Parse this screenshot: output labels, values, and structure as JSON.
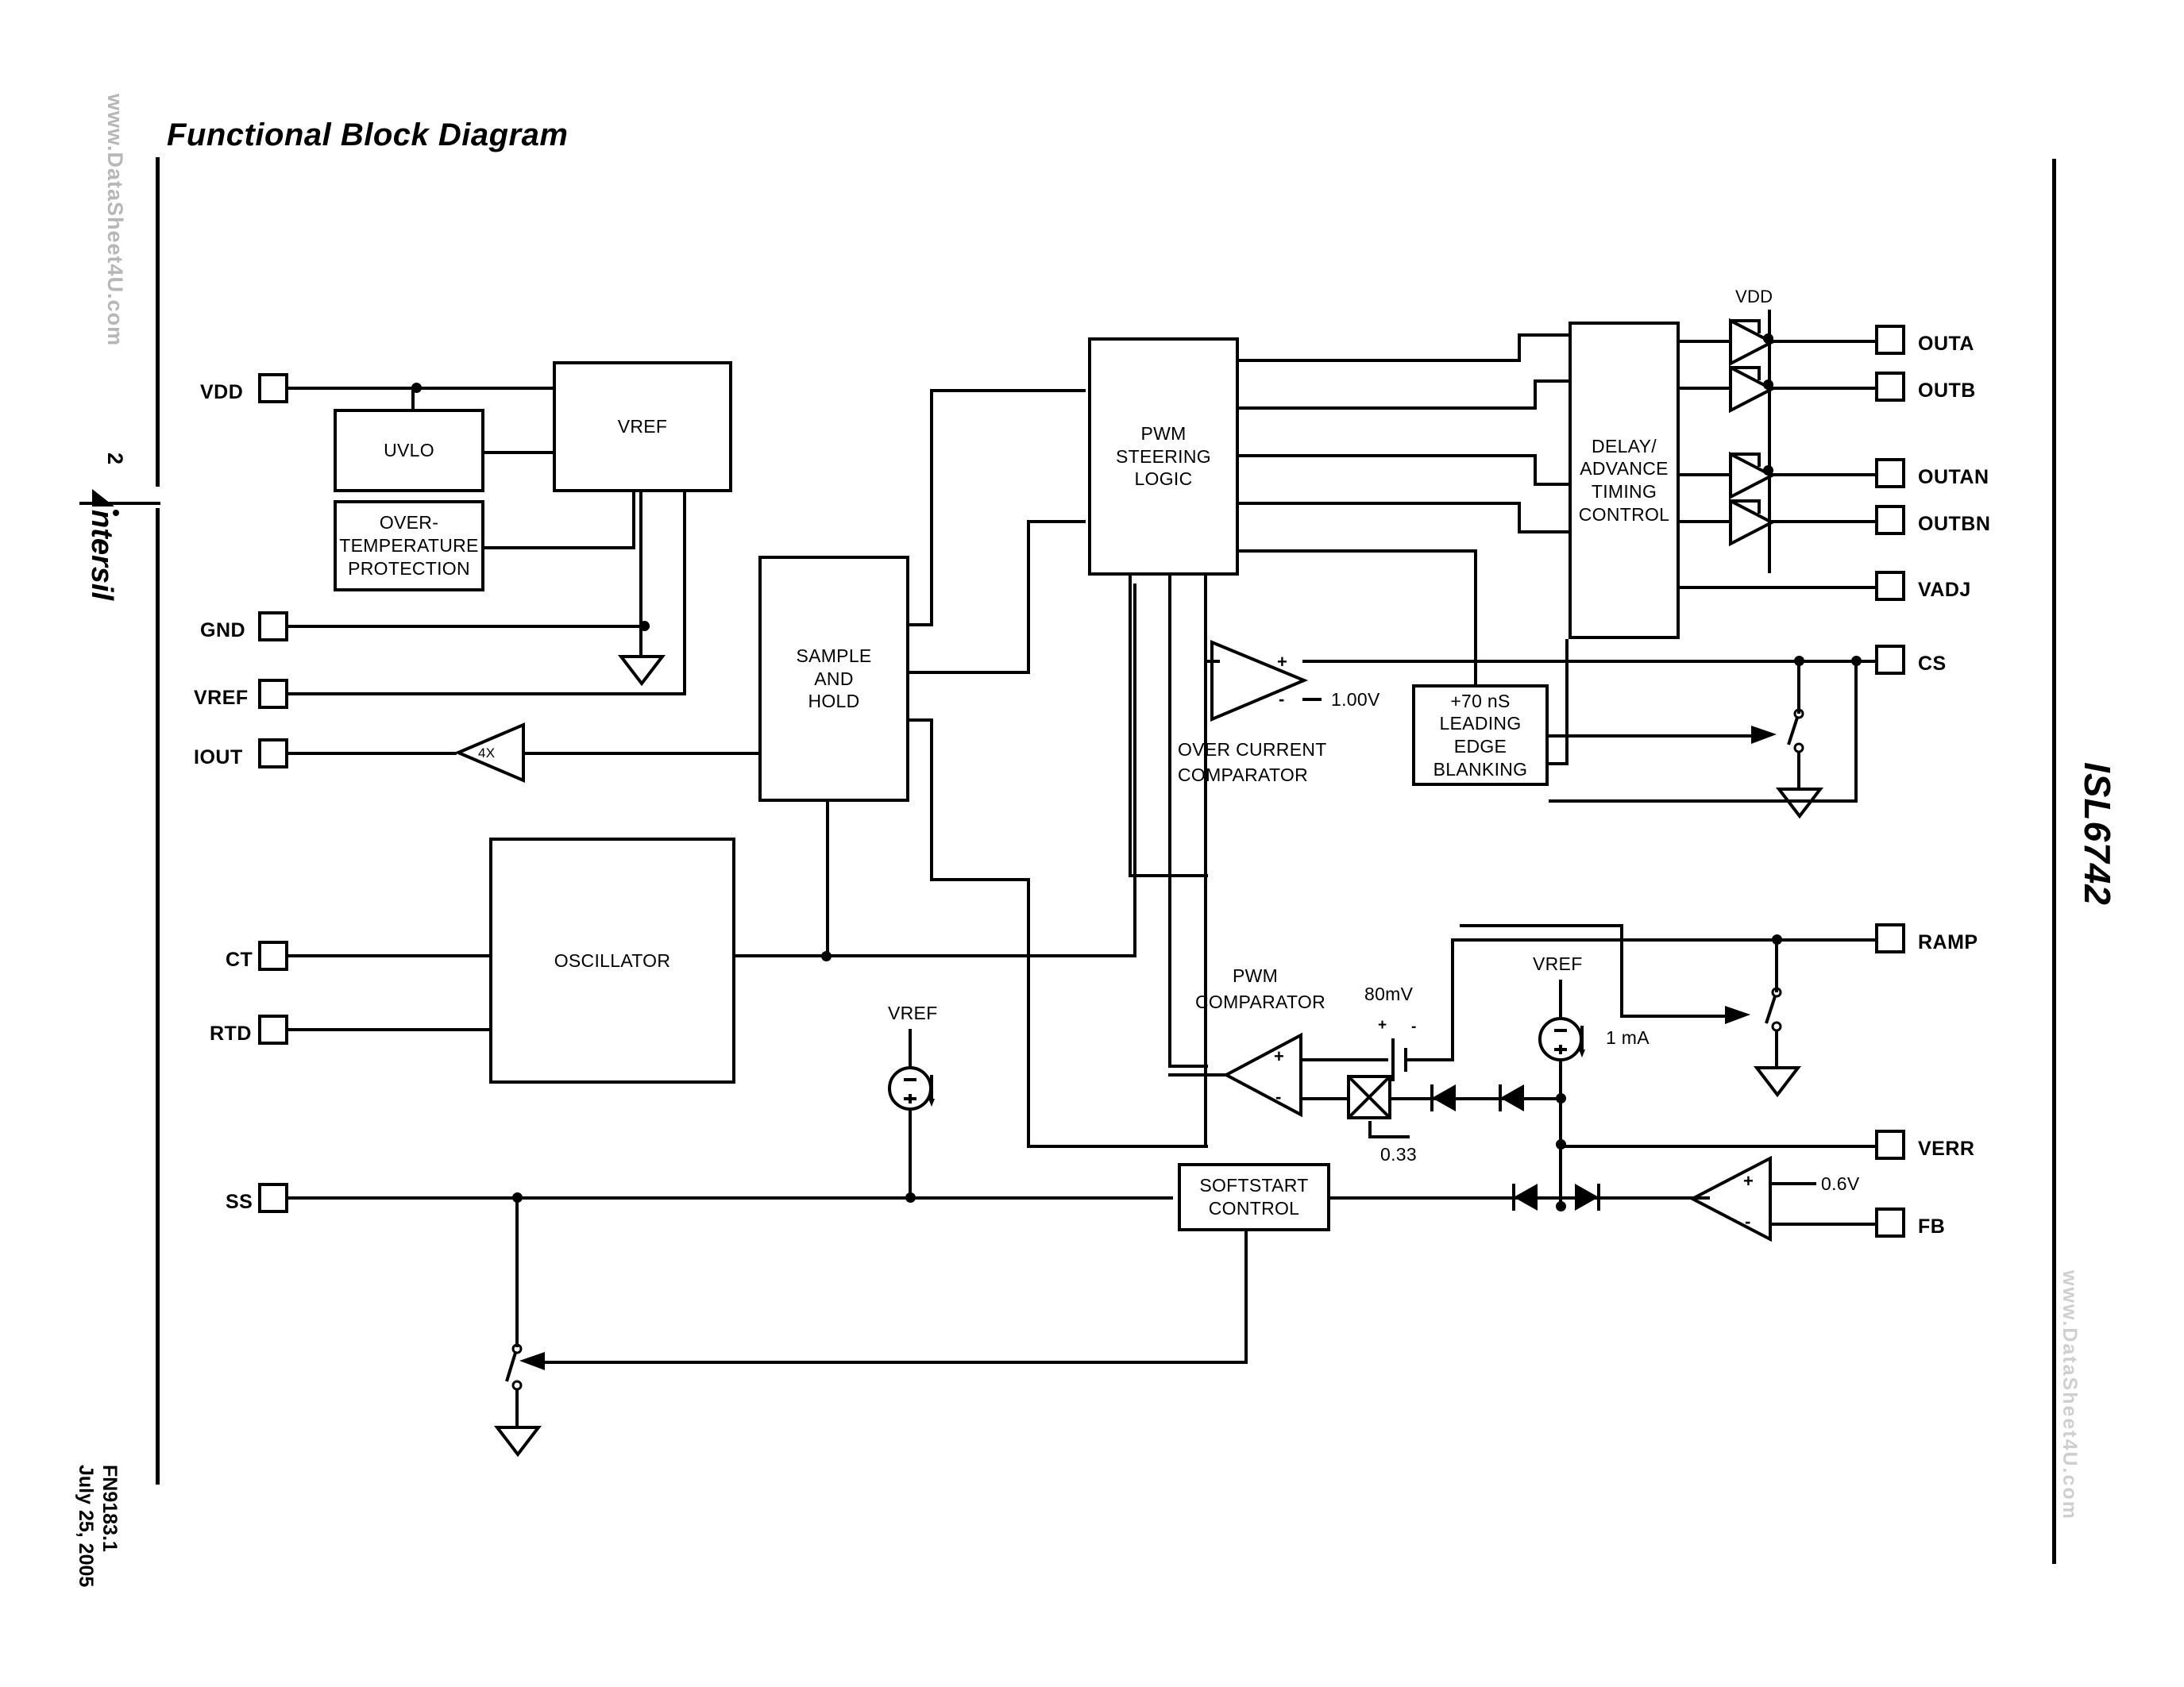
{
  "page": {
    "title": "Functional Block Diagram",
    "page_number": "2",
    "part_number": "ISL6742",
    "doc_number": "FN9183.1",
    "doc_date": "July 25, 2005",
    "company_logo": "intersil",
    "watermark_left": "www.DataSheet4U.com",
    "watermark_right": "www.DataSheet4U.com"
  },
  "pins": {
    "left": [
      {
        "name": "VDD",
        "label": "VDD"
      },
      {
        "name": "GND",
        "label": "GND"
      },
      {
        "name": "VREF",
        "label": "VREF"
      },
      {
        "name": "IOUT",
        "label": "IOUT"
      },
      {
        "name": "CT",
        "label": "CT"
      },
      {
        "name": "RTD",
        "label": "RTD"
      },
      {
        "name": "SS",
        "label": "SS"
      }
    ],
    "right": [
      {
        "name": "OUTA",
        "label": "OUTA"
      },
      {
        "name": "OUTB",
        "label": "OUTB"
      },
      {
        "name": "OUTAN",
        "label": "OUTAN"
      },
      {
        "name": "OUTBN",
        "label": "OUTBN"
      },
      {
        "name": "VADJ",
        "label": "VADJ"
      },
      {
        "name": "CS",
        "label": "CS"
      },
      {
        "name": "RAMP",
        "label": "RAMP"
      },
      {
        "name": "VERR",
        "label": "VERR"
      },
      {
        "name": "FB",
        "label": "FB"
      }
    ]
  },
  "blocks": {
    "uvlo": "UVLO",
    "otp_line1": "OVER-",
    "otp_line2": "TEMPERATURE",
    "otp_line3": "PROTECTION",
    "vref": "VREF",
    "sample_hold_line1": "SAMPLE",
    "sample_hold_line2": "AND",
    "sample_hold_line3": "HOLD",
    "oscillator": "OSCILLATOR",
    "pwm_steering_line1": "PWM",
    "pwm_steering_line2": "STEERING",
    "pwm_steering_line3": "LOGIC",
    "delay_line1": "DELAY/",
    "delay_line2": "ADVANCE",
    "delay_line3": "TIMING",
    "delay_line4": "CONTROL",
    "leb_line1": "+70 nS",
    "leb_line2": "LEADING",
    "leb_line3": "EDGE",
    "leb_line4": "BLANKING",
    "softstart_line1": "SOFTSTART",
    "softstart_line2": "CONTROL"
  },
  "annotations": {
    "vdd_rail": "VDD",
    "gain_4x": "4X",
    "oc_comp_line1": "OVER CURRENT",
    "oc_comp_line2": "COMPARATOR",
    "oc_threshold": "1.00V",
    "pwm_comp_line1": "PWM",
    "pwm_comp_line2": "COMPARATOR",
    "offset_80mv": "80mV",
    "attenuator": "0.33",
    "vref_src_ss": "VREF",
    "vref_src_verr": "VREF",
    "current_1ma": "1 mA",
    "fb_ref": "0.6V",
    "plus": "+",
    "minus": "-"
  }
}
